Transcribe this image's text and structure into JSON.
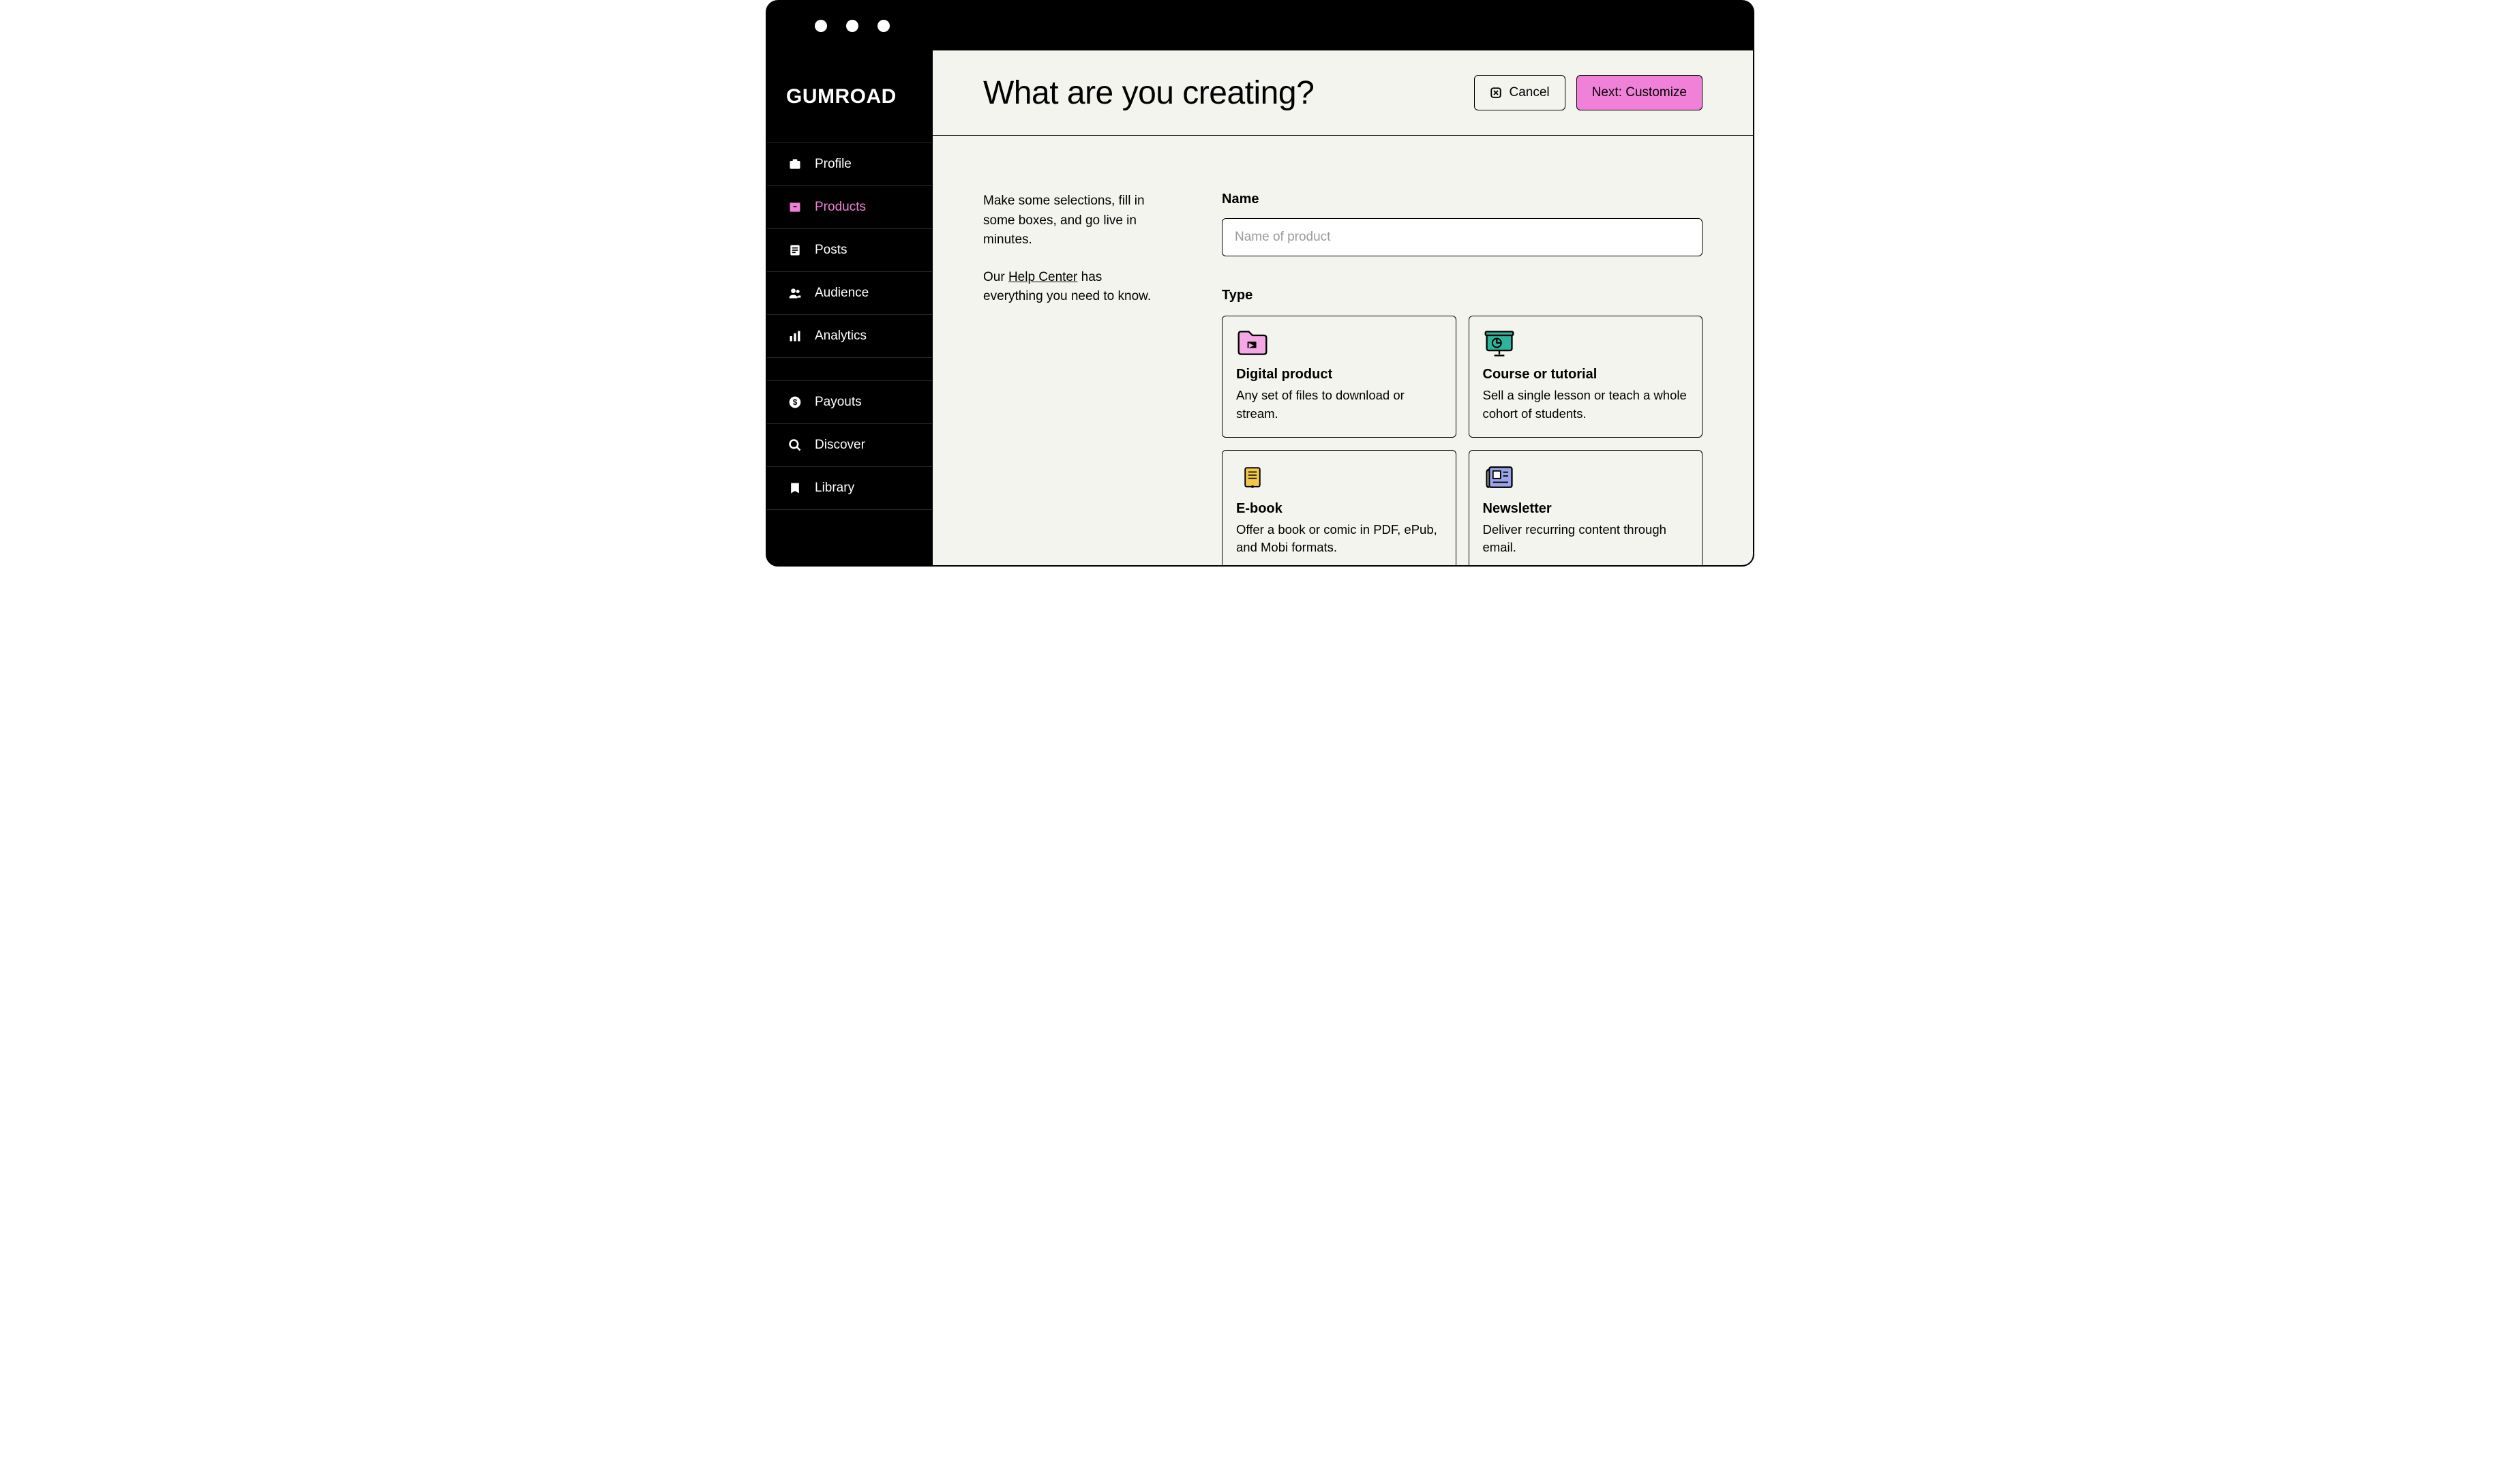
{
  "brand": "GUMROAD",
  "sidebar": {
    "items": [
      {
        "label": "Profile"
      },
      {
        "label": "Products"
      },
      {
        "label": "Posts"
      },
      {
        "label": "Audience"
      },
      {
        "label": "Analytics"
      },
      {
        "label": "Payouts"
      },
      {
        "label": "Discover"
      },
      {
        "label": "Library"
      }
    ]
  },
  "header": {
    "title": "What are you creating?",
    "cancel_label": "Cancel",
    "next_label": "Next: Customize"
  },
  "intro": {
    "p1": "Make some selections, fill in some boxes, and go live in minutes.",
    "p2_pre": "Our ",
    "p2_link": "Help Center",
    "p2_post": " has everything you need to know."
  },
  "form": {
    "name_label": "Name",
    "name_placeholder": "Name of product",
    "name_value": "",
    "type_label": "Type",
    "types": [
      {
        "title": "Digital product",
        "desc": "Any set of files to download or stream."
      },
      {
        "title": "Course or tutorial",
        "desc": "Sell a single lesson or teach a whole cohort of students."
      },
      {
        "title": "E-book",
        "desc": "Offer a book or comic in PDF, ePub, and Mobi formats."
      },
      {
        "title": "Newsletter",
        "desc": "Deliver recurring content through email."
      }
    ]
  }
}
